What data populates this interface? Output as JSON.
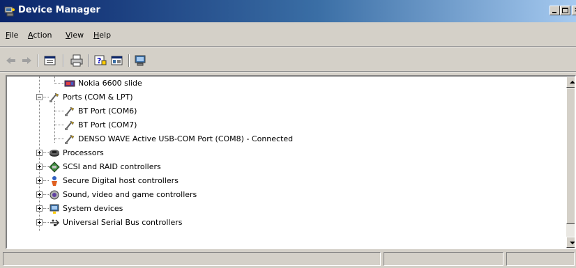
{
  "window": {
    "title": "Device Manager",
    "controls": [
      "minimize",
      "maximize",
      "close"
    ],
    "close_glyph": "×"
  },
  "menu": {
    "items": [
      {
        "label": "File",
        "accel": "F",
        "rest": "ile"
      },
      {
        "label": "Action",
        "accel": "A",
        "rest": "ction"
      },
      {
        "label": "View",
        "accel": "V",
        "rest": "iew"
      },
      {
        "label": "Help",
        "accel": "H",
        "rest": "elp"
      }
    ]
  },
  "toolbar": {
    "buttons": [
      "back-arrow-icon",
      "forward-arrow-icon",
      "properties-icon",
      "print-icon",
      "help-icon",
      "console-view-icon",
      "scan-hardware-icon"
    ]
  },
  "tree": {
    "items": [
      {
        "label": "Nokia 6600 slide",
        "icon": "phone-device-icon",
        "level": 2
      },
      {
        "label": "Ports (COM & LPT)",
        "icon": "port-icon",
        "level": 1,
        "expanded": true
      },
      {
        "label": "BT Port (COM6)",
        "icon": "port-icon",
        "level": 2
      },
      {
        "label": "BT Port (COM7)",
        "icon": "port-icon",
        "level": 2
      },
      {
        "label": "DENSO WAVE Active USB-COM Port (COM8) - Connected",
        "icon": "port-icon",
        "level": 2
      },
      {
        "label": "Processors",
        "icon": "processor-icon",
        "level": 1,
        "expanded": false
      },
      {
        "label": "SCSI and RAID controllers",
        "icon": "scsi-icon",
        "level": 1,
        "expanded": false
      },
      {
        "label": "Secure Digital host controllers",
        "icon": "sd-controller-icon",
        "level": 1,
        "expanded": false
      },
      {
        "label": "Sound, video and game controllers",
        "icon": "sound-icon",
        "level": 1,
        "expanded": false
      },
      {
        "label": "System devices",
        "icon": "system-devices-icon",
        "level": 1,
        "expanded": false
      },
      {
        "label": "Universal Serial Bus controllers",
        "icon": "usb-icon",
        "level": 1,
        "expanded": false
      }
    ]
  },
  "colors": {
    "titlebar_start": "#0a246a",
    "titlebar_end": "#a6caf0",
    "chrome": "#d4d0c8",
    "tree_background": "#ffffff"
  }
}
